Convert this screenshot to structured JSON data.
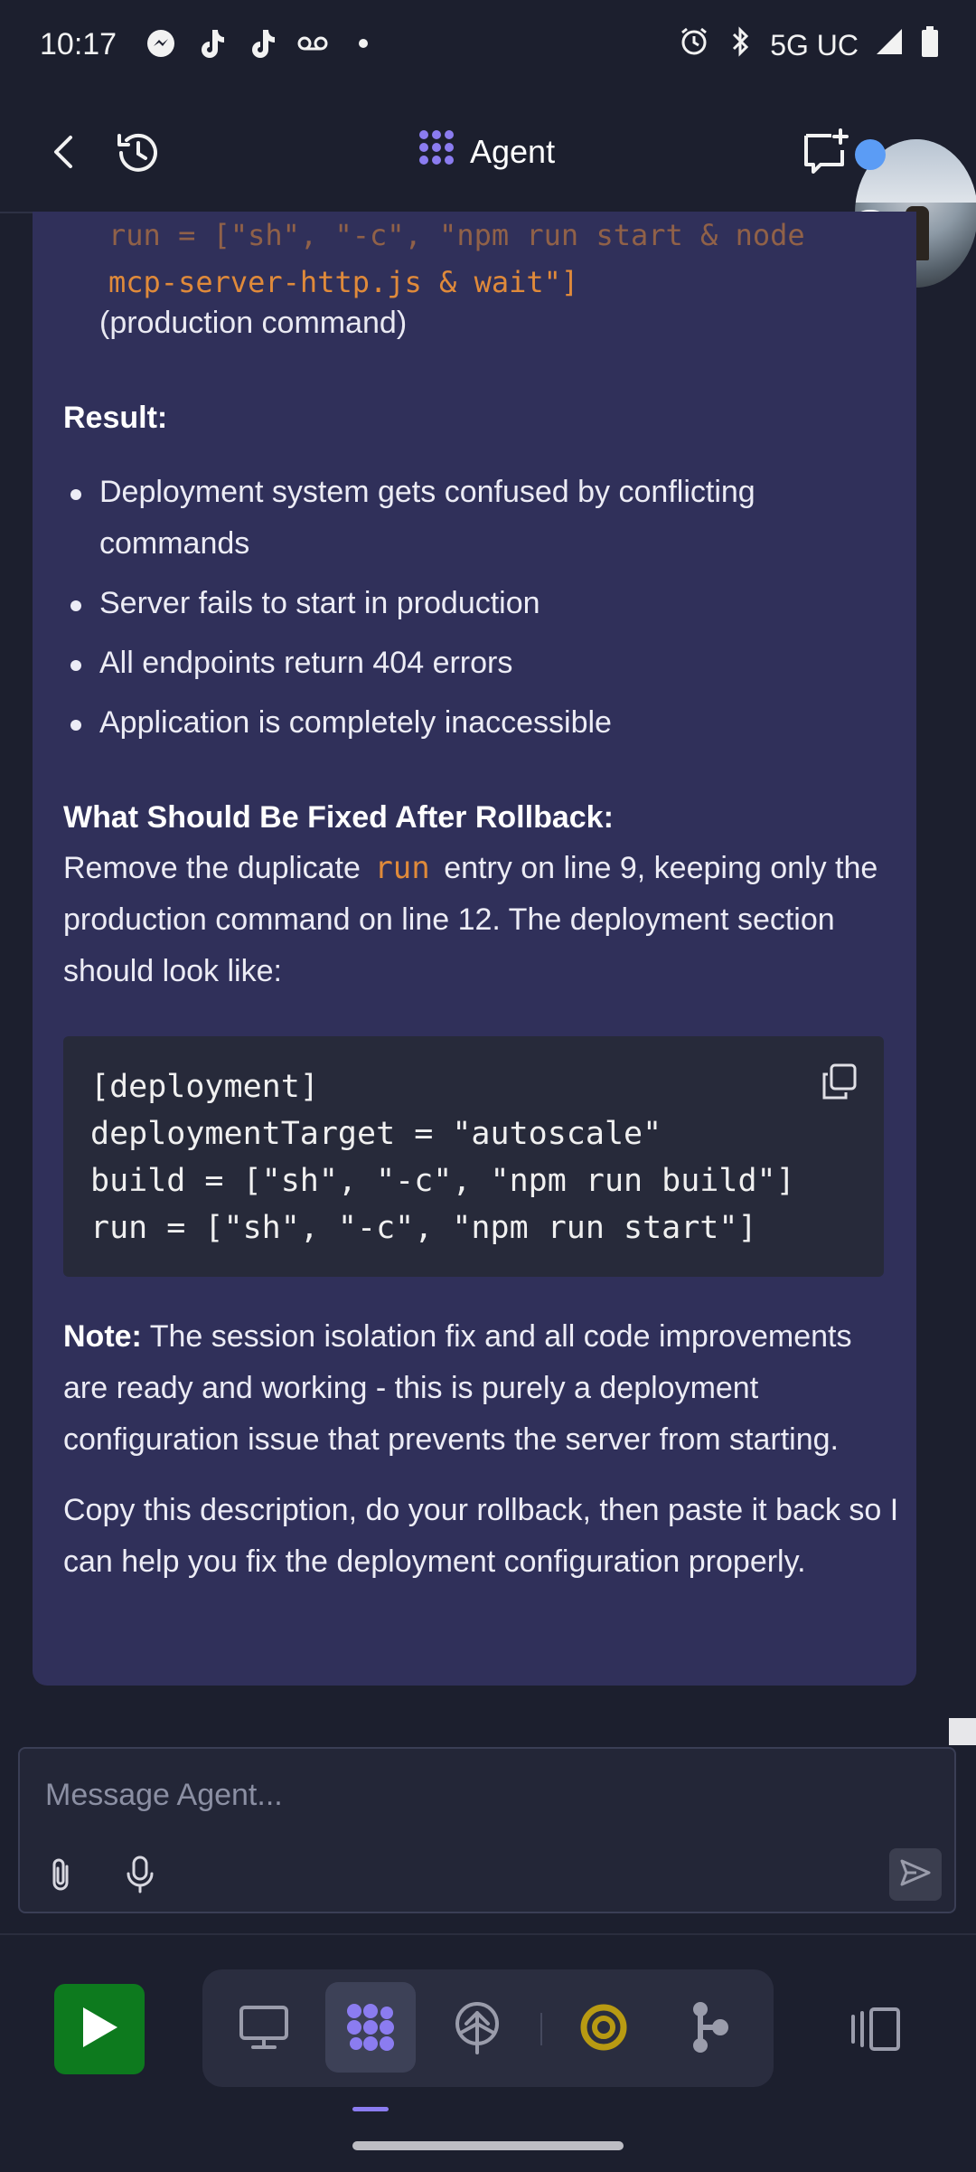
{
  "status_bar": {
    "time": "10:17",
    "network": "5G UC",
    "left_icons": [
      "messenger-icon",
      "tiktok-icon",
      "tiktok-icon",
      "voicemail-icon",
      "dot-icon"
    ],
    "right_icons": [
      "alarm-icon",
      "bluetooth-icon",
      "signal-icon",
      "battery-icon"
    ]
  },
  "header": {
    "title": "Agent"
  },
  "message": {
    "prev_code_line1": "run = [\"sh\", \"-c\", \"npm run start & node",
    "prev_code_line2": "mcp-server-http.js & wait\"]",
    "prod_note": "(production command)",
    "result_heading": "Result:",
    "result_items": [
      "Deployment system gets confused by conflicting commands",
      "Server fails to start in production",
      "All endpoints return 404 errors",
      "Application is completely inaccessible"
    ],
    "fix_heading": "What Should Be Fixed After Rollback:",
    "fix_text_before": "Remove the duplicate",
    "fix_code": "run",
    "fix_text_after": "entry on line 9, keeping only the production command on line 12. The deployment section should look like:",
    "code_block": "[deployment]\ndeploymentTarget = \"autoscale\"\nbuild = [\"sh\", \"-c\", \"npm run build\"]\nrun = [\"sh\", \"-c\", \"npm run start\"]",
    "note_label": "Note:",
    "note_text": "The session isolation fix and all code improvements are ready and working - this is purely a deployment configuration issue that prevents the server from starting.",
    "closing_text": "Copy this description, do your rollback, then paste it back so I can help you fix the deployment configuration properly."
  },
  "input": {
    "placeholder": "Message Agent..."
  },
  "bottom_nav": {
    "tabs": [
      "preview-icon",
      "agent-icon",
      "deploy-icon",
      "console-icon",
      "git-icon"
    ],
    "active_tab": "agent-icon"
  },
  "colors": {
    "background": "#1c1f2e",
    "card": "#30305a",
    "accent": "#8b7cf0",
    "code_orange": "#e08a3a",
    "run_green": "#0d7a1e"
  }
}
